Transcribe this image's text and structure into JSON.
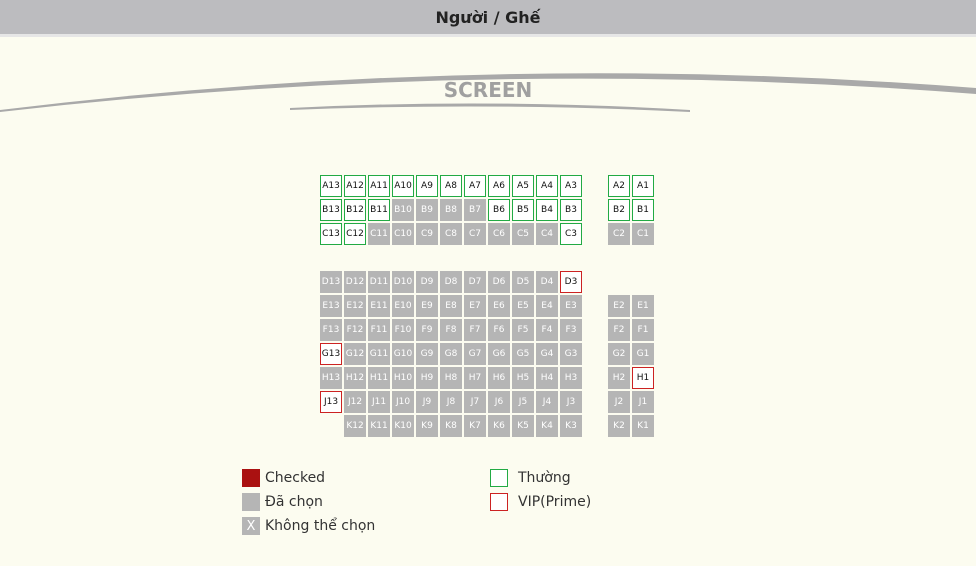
{
  "header": {
    "title": "Người / Ghế"
  },
  "screen": {
    "label": "SCREEN"
  },
  "seats": {
    "rows": [
      {
        "row": "A",
        "seats": [
          {
            "id": "A13",
            "state": "normal"
          },
          {
            "id": "A12",
            "state": "normal"
          },
          {
            "id": "A11",
            "state": "normal"
          },
          {
            "id": "A10",
            "state": "normal"
          },
          {
            "id": "A9",
            "state": "normal"
          },
          {
            "id": "A8",
            "state": "normal"
          },
          {
            "id": "A7",
            "state": "normal"
          },
          {
            "id": "A6",
            "state": "normal"
          },
          {
            "id": "A5",
            "state": "normal"
          },
          {
            "id": "A4",
            "state": "normal"
          },
          {
            "id": "A3",
            "state": "normal"
          },
          {
            "id": "A2",
            "state": "normal"
          },
          {
            "id": "A1",
            "state": "normal"
          }
        ]
      },
      {
        "row": "B",
        "seats": [
          {
            "id": "B13",
            "state": "normal"
          },
          {
            "id": "B12",
            "state": "normal"
          },
          {
            "id": "B11",
            "state": "normal"
          },
          {
            "id": "B10",
            "state": "taken"
          },
          {
            "id": "B9",
            "state": "taken"
          },
          {
            "id": "B8",
            "state": "taken"
          },
          {
            "id": "B7",
            "state": "taken"
          },
          {
            "id": "B6",
            "state": "normal"
          },
          {
            "id": "B5",
            "state": "normal"
          },
          {
            "id": "B4",
            "state": "normal"
          },
          {
            "id": "B3",
            "state": "normal"
          },
          {
            "id": "B2",
            "state": "normal"
          },
          {
            "id": "B1",
            "state": "normal"
          }
        ]
      },
      {
        "row": "C",
        "seats": [
          {
            "id": "C13",
            "state": "normal"
          },
          {
            "id": "C12",
            "state": "normal"
          },
          {
            "id": "C11",
            "state": "taken"
          },
          {
            "id": "C10",
            "state": "taken"
          },
          {
            "id": "C9",
            "state": "taken"
          },
          {
            "id": "C8",
            "state": "taken"
          },
          {
            "id": "C7",
            "state": "taken"
          },
          {
            "id": "C6",
            "state": "taken"
          },
          {
            "id": "C5",
            "state": "taken"
          },
          {
            "id": "C4",
            "state": "taken"
          },
          {
            "id": "C3",
            "state": "normal"
          },
          {
            "id": "C2",
            "state": "taken"
          },
          {
            "id": "C1",
            "state": "taken"
          }
        ]
      },
      {
        "row": "D",
        "seats": [
          {
            "id": "D13",
            "state": "taken"
          },
          {
            "id": "D12",
            "state": "taken"
          },
          {
            "id": "D11",
            "state": "taken"
          },
          {
            "id": "D10",
            "state": "taken"
          },
          {
            "id": "D9",
            "state": "taken"
          },
          {
            "id": "D8",
            "state": "taken"
          },
          {
            "id": "D7",
            "state": "taken"
          },
          {
            "id": "D6",
            "state": "taken"
          },
          {
            "id": "D5",
            "state": "taken"
          },
          {
            "id": "D4",
            "state": "taken"
          },
          {
            "id": "D3",
            "state": "vip"
          },
          {
            "id": "",
            "state": "none"
          },
          {
            "id": "",
            "state": "none"
          }
        ]
      },
      {
        "row": "E",
        "seats": [
          {
            "id": "E13",
            "state": "taken"
          },
          {
            "id": "E12",
            "state": "taken"
          },
          {
            "id": "E11",
            "state": "taken"
          },
          {
            "id": "E10",
            "state": "taken"
          },
          {
            "id": "E9",
            "state": "taken"
          },
          {
            "id": "E8",
            "state": "taken"
          },
          {
            "id": "E7",
            "state": "taken"
          },
          {
            "id": "E6",
            "state": "taken"
          },
          {
            "id": "E5",
            "state": "taken"
          },
          {
            "id": "E4",
            "state": "taken"
          },
          {
            "id": "E3",
            "state": "taken"
          },
          {
            "id": "E2",
            "state": "taken"
          },
          {
            "id": "E1",
            "state": "taken"
          }
        ]
      },
      {
        "row": "F",
        "seats": [
          {
            "id": "F13",
            "state": "taken"
          },
          {
            "id": "F12",
            "state": "taken"
          },
          {
            "id": "F11",
            "state": "taken"
          },
          {
            "id": "F10",
            "state": "taken"
          },
          {
            "id": "F9",
            "state": "taken"
          },
          {
            "id": "F8",
            "state": "taken"
          },
          {
            "id": "F7",
            "state": "taken"
          },
          {
            "id": "F6",
            "state": "taken"
          },
          {
            "id": "F5",
            "state": "taken"
          },
          {
            "id": "F4",
            "state": "taken"
          },
          {
            "id": "F3",
            "state": "taken"
          },
          {
            "id": "F2",
            "state": "taken"
          },
          {
            "id": "F1",
            "state": "taken"
          }
        ]
      },
      {
        "row": "G",
        "seats": [
          {
            "id": "G13",
            "state": "vip"
          },
          {
            "id": "G12",
            "state": "taken"
          },
          {
            "id": "G11",
            "state": "taken"
          },
          {
            "id": "G10",
            "state": "taken"
          },
          {
            "id": "G9",
            "state": "taken"
          },
          {
            "id": "G8",
            "state": "taken"
          },
          {
            "id": "G7",
            "state": "taken"
          },
          {
            "id": "G6",
            "state": "taken"
          },
          {
            "id": "G5",
            "state": "taken"
          },
          {
            "id": "G4",
            "state": "taken"
          },
          {
            "id": "G3",
            "state": "taken"
          },
          {
            "id": "G2",
            "state": "taken"
          },
          {
            "id": "G1",
            "state": "taken"
          }
        ]
      },
      {
        "row": "H",
        "seats": [
          {
            "id": "H13",
            "state": "taken"
          },
          {
            "id": "H12",
            "state": "taken"
          },
          {
            "id": "H11",
            "state": "taken"
          },
          {
            "id": "H10",
            "state": "taken"
          },
          {
            "id": "H9",
            "state": "taken"
          },
          {
            "id": "H8",
            "state": "taken"
          },
          {
            "id": "H7",
            "state": "taken"
          },
          {
            "id": "H6",
            "state": "taken"
          },
          {
            "id": "H5",
            "state": "taken"
          },
          {
            "id": "H4",
            "state": "taken"
          },
          {
            "id": "H3",
            "state": "taken"
          },
          {
            "id": "H2",
            "state": "taken"
          },
          {
            "id": "H1",
            "state": "vip"
          }
        ]
      },
      {
        "row": "J",
        "seats": [
          {
            "id": "J13",
            "state": "vip"
          },
          {
            "id": "J12",
            "state": "taken"
          },
          {
            "id": "J11",
            "state": "taken"
          },
          {
            "id": "J10",
            "state": "taken"
          },
          {
            "id": "J9",
            "state": "taken"
          },
          {
            "id": "J8",
            "state": "taken"
          },
          {
            "id": "J7",
            "state": "taken"
          },
          {
            "id": "J6",
            "state": "taken"
          },
          {
            "id": "J5",
            "state": "taken"
          },
          {
            "id": "J4",
            "state": "taken"
          },
          {
            "id": "J3",
            "state": "taken"
          },
          {
            "id": "J2",
            "state": "taken"
          },
          {
            "id": "J1",
            "state": "taken"
          }
        ]
      },
      {
        "row": "K",
        "seats": [
          {
            "id": "",
            "state": "none"
          },
          {
            "id": "K12",
            "state": "taken"
          },
          {
            "id": "K11",
            "state": "taken"
          },
          {
            "id": "K10",
            "state": "taken"
          },
          {
            "id": "K9",
            "state": "taken"
          },
          {
            "id": "K8",
            "state": "taken"
          },
          {
            "id": "K7",
            "state": "taken"
          },
          {
            "id": "K6",
            "state": "taken"
          },
          {
            "id": "K5",
            "state": "taken"
          },
          {
            "id": "K4",
            "state": "taken"
          },
          {
            "id": "K3",
            "state": "taken"
          },
          {
            "id": "K2",
            "state": "taken"
          },
          {
            "id": "K1",
            "state": "taken"
          }
        ]
      }
    ]
  },
  "legend": {
    "checked": "Checked",
    "taken": "Đã chọn",
    "unavailable": "Không thể chọn",
    "unavailable_mark": "X",
    "normal": "Thường",
    "vip": "VIP(Prime)"
  },
  "colors": {
    "checked": "#aa1111",
    "taken": "#b5b5b5",
    "normal_border": "#22aa44",
    "vip_border": "#cc2222"
  }
}
